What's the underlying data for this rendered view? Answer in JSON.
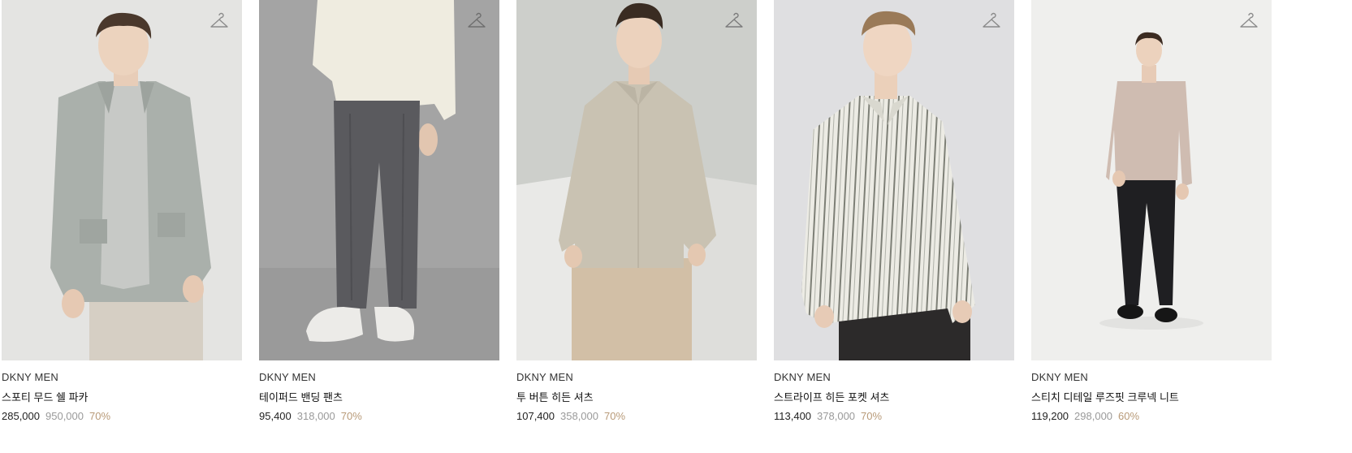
{
  "products": [
    {
      "brand": "DKNY MEN",
      "name": "스포티 무드 쉘 파카",
      "sale_price": "285,000",
      "original_price": "950,000",
      "discount": "70%"
    },
    {
      "brand": "DKNY MEN",
      "name": "테이퍼드 밴딩 팬츠",
      "sale_price": "95,400",
      "original_price": "318,000",
      "discount": "70%"
    },
    {
      "brand": "DKNY MEN",
      "name": "투 버튼 히든 셔츠",
      "sale_price": "107,400",
      "original_price": "358,000",
      "discount": "70%"
    },
    {
      "brand": "DKNY MEN",
      "name": "스트라이프 히든 포켓 셔츠",
      "sale_price": "113,400",
      "original_price": "378,000",
      "discount": "70%"
    },
    {
      "brand": "DKNY MEN",
      "name": "스티치 디테일 루즈핏 크루넥 니트",
      "sale_price": "119,200",
      "original_price": "298,000",
      "discount": "60%"
    }
  ],
  "icons": {
    "wishlist": "hanger-icon"
  },
  "colors": {
    "discount": "#b89a78",
    "original_price": "#9a9a9a"
  }
}
